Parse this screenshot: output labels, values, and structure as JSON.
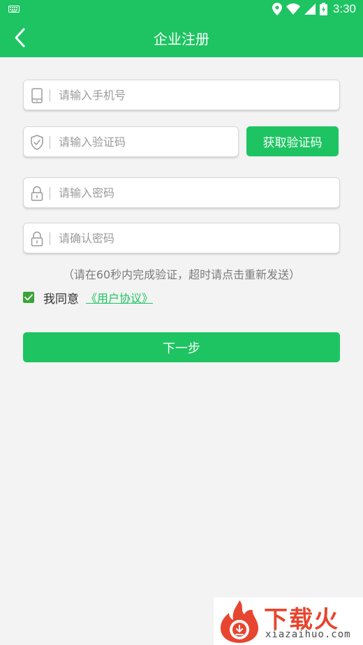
{
  "status_bar": {
    "time": "3:30",
    "icons": [
      "keyboard-icon",
      "location-icon",
      "wifi-icon",
      "signal-icon",
      "battery-charging-icon"
    ]
  },
  "header": {
    "title": "企业注册",
    "back_icon": "chevron-left-icon",
    "background_color": "#1ec462"
  },
  "form": {
    "phone": {
      "placeholder": "请输入手机号",
      "value": "",
      "icon": "phone-icon"
    },
    "code": {
      "placeholder": "请输入验证码",
      "value": "",
      "icon": "shield-check-icon"
    },
    "get_code_label": "获取验证码",
    "password": {
      "placeholder": "请输入密码",
      "value": "",
      "icon": "lock-icon"
    },
    "confirm_password": {
      "placeholder": "请确认密码",
      "value": "",
      "icon": "lock-icon"
    },
    "hint": "（请在60秒内完成验证，超时请点击重新发送）",
    "agree_checked": true,
    "agree_text": "我同意",
    "agreement_link": "《用户协议》",
    "next_label": "下一步"
  },
  "watermark": {
    "title": "下载火",
    "url": "xiazaihuo.com"
  },
  "colors": {
    "accent": "#1ec462",
    "checkbox": "#3aa336",
    "background": "#f3f3f3",
    "watermark_red": "#e7452f"
  }
}
